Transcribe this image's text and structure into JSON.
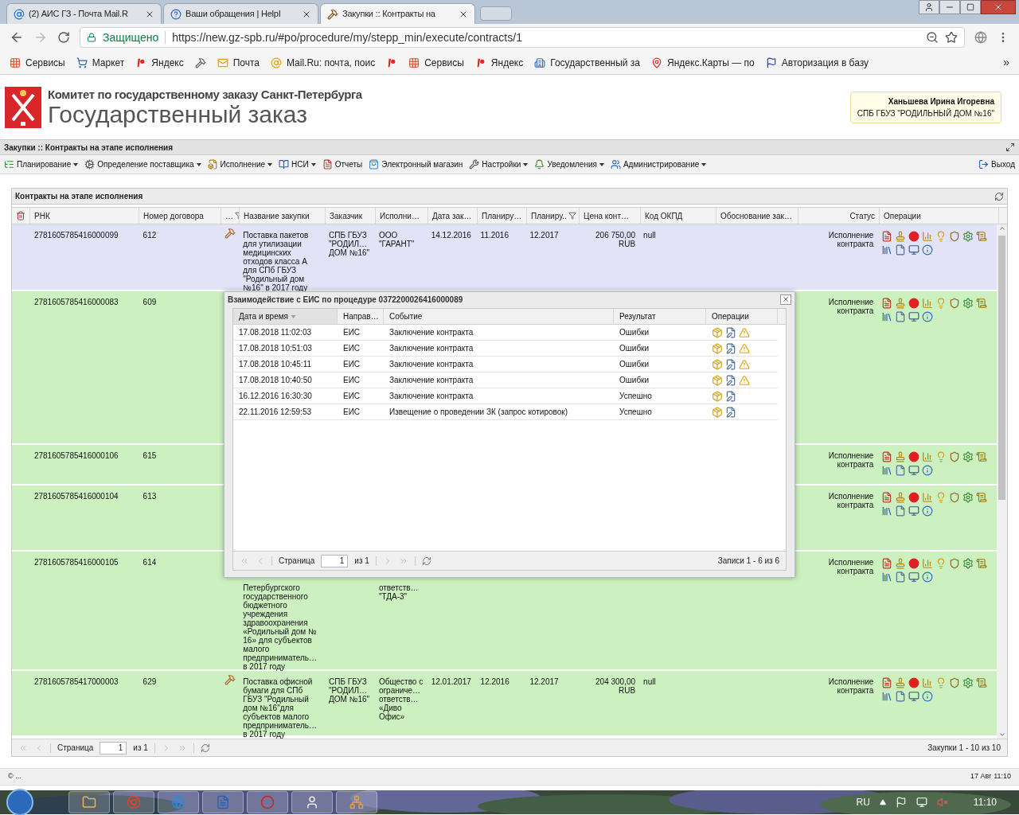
{
  "browser": {
    "tabs": [
      {
        "title": "(2) АИС ГЗ - Почта Mail.R",
        "kind": "mail",
        "selected": false
      },
      {
        "title": "Ваши обращения | HelpI",
        "kind": "help",
        "selected": false
      },
      {
        "title": "Закупки :: Контракты на",
        "kind": "hammer",
        "selected": true
      }
    ],
    "security": "Защищено",
    "url": "https://new.gz-spb.ru/#po/procedure/my/stepp_min/execute/contracts/1",
    "bookmarks": [
      {
        "label": "Сервисы",
        "kind": "apps"
      },
      {
        "label": "Маркет",
        "kind": "cart"
      },
      {
        "label": "Яндекс",
        "kind": "logo"
      },
      {
        "kind": "hammer"
      },
      {
        "label": "Почта",
        "kind": "mail"
      },
      {
        "label": "Mail.Ru: почта, поис",
        "kind": "at"
      },
      {
        "kind": "logo"
      },
      {
        "label": "Сервисы",
        "kind": "apps"
      },
      {
        "label": "Яндекс",
        "kind": "logo"
      },
      {
        "label": "Государственный за",
        "kind": "gov"
      },
      {
        "label": "Яндекс.Карты — по",
        "kind": "pin"
      },
      {
        "label": "Авторизация в базу",
        "kind": "flag"
      }
    ],
    "more": "»"
  },
  "header": {
    "org": "Комитет по государственному заказу Санкт-Петербурга",
    "product": "Государственный заказ",
    "user_name": "Ханьшева Ирина Игоревна",
    "user_org": "СПБ ГБУЗ \"РОДИЛЬНЫЙ ДОМ №16\""
  },
  "module_title": "Закупки :: Контракты на этапе исполнения",
  "menu": {
    "items": [
      {
        "label": "Планирование",
        "kind": "plan",
        "dropdown": true
      },
      {
        "label": "Определение поставщика",
        "kind": "gears",
        "dropdown": true
      },
      {
        "label": "Исполнение",
        "kind": "exec",
        "dropdown": true
      },
      {
        "label": "НСИ",
        "kind": "book",
        "dropdown": true
      },
      {
        "label": "Отчеты",
        "kind": "report",
        "dropdown": false
      },
      {
        "label": "Электронный магазин",
        "kind": "shop",
        "dropdown": false
      },
      {
        "label": "Настройки",
        "kind": "wrench",
        "dropdown": true
      },
      {
        "label": "Уведомления",
        "kind": "bell",
        "dropdown": true
      },
      {
        "label": "Администрирование",
        "kind": "admin",
        "dropdown": true
      }
    ],
    "logout": "Выход"
  },
  "grid": {
    "title": "Контракты на этапе исполнения",
    "columns": [
      {
        "label": "РНК",
        "filtered": false
      },
      {
        "label": "Номер договора",
        "filtered": false
      },
      {
        "label": "…",
        "filtered": true
      },
      {
        "label": "Название закупки",
        "filtered": false
      },
      {
        "label": "Заказчик",
        "filtered": false
      },
      {
        "label": "Исполни…",
        "filtered": false
      },
      {
        "label": "Дата зак…",
        "filtered": false
      },
      {
        "label": "Планиру…",
        "filtered": false
      },
      {
        "label": "Планиру..",
        "filtered": true
      },
      {
        "label": "Цена конт…",
        "filtered": false
      },
      {
        "label": "Код ОКПД",
        "filtered": false
      },
      {
        "label": "Обоснование зак…",
        "filtered": false
      },
      {
        "label": "Статус",
        "filtered": false
      },
      {
        "label": "Операции",
        "filtered": false
      }
    ],
    "rows": [
      {
        "rnk": "2781605785416000099",
        "number": "612",
        "auction": true,
        "name": "Поставка пакетов для утилизации медицинских отходов класса А для СПб ГБУЗ \"Родильный дом №16\" в 2017 году",
        "customer": "СПБ ГБУЗ \"РОДИЛ… ДОМ №16\"",
        "supplier": "ООО \"ГАРАНТ\"",
        "date": "14.12.2016",
        "plan_start": "11.2016",
        "plan_end": "12.2017",
        "price": "206 750,00 RUB",
        "okpd": "null",
        "status": "Исполнение контракта",
        "selected": true
      },
      {
        "rnk": "2781605785416000083",
        "number": "609",
        "auction": false,
        "status": "Исполнение контракта",
        "selected": false
      },
      {
        "rnk": "2781605785416000106",
        "number": "615",
        "auction": false,
        "status": "Исполнение контракта",
        "selected": false
      },
      {
        "rnk": "2781605785416000104",
        "number": "613",
        "auction": false,
        "status": "Исполнение контракта",
        "selected": false
      },
      {
        "rnk": "2781605785416000105",
        "number": "614",
        "auction": false,
        "name": "Петербургского государственного бюджетного учреждения здравоохранения «Родильный дом № 16» для субъектов малого предприниматель… в 2017 году",
        "supplier": "ответств… \"ТДА-3\"",
        "status": "Исполнение контракта",
        "selected": false
      },
      {
        "rnk": "2781605785417000003",
        "number": "629",
        "auction": true,
        "name": "Поставка офисной бумаги для СПб ГБУЗ \"Родильный дом №16\"для субъектов малого предприниматель… в 2017 году",
        "customer": "СПБ ГБУЗ \"РОДИЛ… ДОМ №16\"",
        "supplier": "Общество с ограниче… ответств… «Диво Офис»",
        "date": "12.01.2017",
        "plan_start": "12.2016",
        "plan_end": "12.2017",
        "price": "204 300,00 RUB",
        "okpd": "null",
        "status": "Исполнение контракта",
        "selected": false
      }
    ],
    "pager": {
      "page_label": "Страница",
      "page": "1",
      "of": "из 1",
      "summary": "Закупки 1 - 10 из 10"
    }
  },
  "dialog": {
    "title": "Взаимодействие с ЕИС по процедуре 0372200026416000089",
    "columns": [
      {
        "label": "Дата и время",
        "sorted": true
      },
      {
        "label": "Направ…",
        "sorted": false
      },
      {
        "label": "Событие",
        "sorted": false
      },
      {
        "label": "Результат",
        "sorted": false
      },
      {
        "label": "Операции",
        "sorted": false
      }
    ],
    "rows": [
      {
        "datetime": "17.08.2018 11:02:03",
        "direction": "ЕИС",
        "event": "Заключение контракта",
        "result": "Ошибки",
        "warning": true
      },
      {
        "datetime": "17.08.2018 10:51:03",
        "direction": "ЕИС",
        "event": "Заключение контракта",
        "result": "Ошибки",
        "warning": true
      },
      {
        "datetime": "17.08.2018 10:45:11",
        "direction": "ЕИС",
        "event": "Заключение контракта",
        "result": "Ошибки",
        "warning": true
      },
      {
        "datetime": "17.08.2018 10:40:50",
        "direction": "ЕИС",
        "event": "Заключение контракта",
        "result": "Ошибки",
        "warning": true
      },
      {
        "datetime": "16.12.2016 16:30:30",
        "direction": "ЕИС",
        "event": "Заключение контракта",
        "result": "Успешно",
        "warning": false
      },
      {
        "datetime": "22.11.2016 12:59:53",
        "direction": "ЕИС",
        "event": "Извещение о проведении ЗК (запрос котировок)",
        "result": "Успешно",
        "warning": false
      }
    ],
    "pager": {
      "page_label": "Страница",
      "page": "1",
      "of": "из 1",
      "summary": "Записи 1 - 6 из 6"
    }
  },
  "status_bar": {
    "left": "© ...",
    "right": "17 Авг 11:10"
  },
  "taskbar": {
    "language": "RU",
    "clock": "11:10"
  }
}
